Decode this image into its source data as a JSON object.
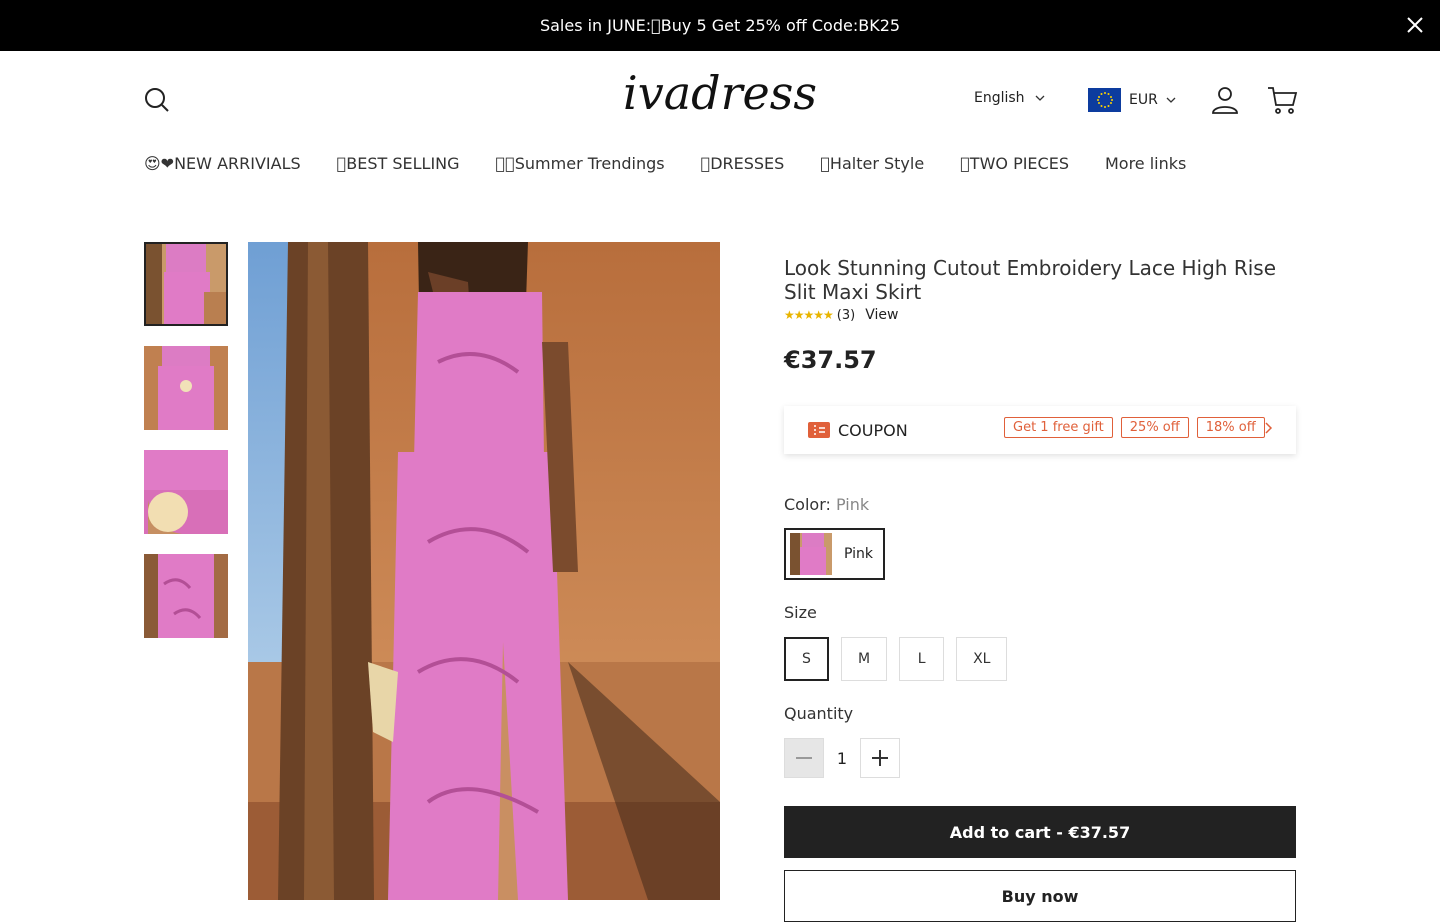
{
  "announcement": {
    "text": "Sales in JUNE:\u0000Buy 5 Get 25% off Code:BK25"
  },
  "header": {
    "logo_text": "ivadress",
    "language": "English",
    "currency": "EUR"
  },
  "nav": {
    "items": [
      "😍❤NEW ARRIVIALS",
      "\u0000BEST SELLING",
      "\u0000\u0000Summer Trendings",
      "\u0000DRESSES",
      "\u0000Halter Style",
      "\u0000TWO PIECES",
      "More links"
    ]
  },
  "product": {
    "title": "Look Stunning Cutout Embroidery Lace High Rise Slit Maxi Skirt",
    "stars": "★★★★★",
    "review_count": "(3)",
    "view_label": "View",
    "price": "€37.57",
    "coupon": {
      "label": "COUPON",
      "tags": [
        "Get 1 free gift",
        "25% off",
        "18% off"
      ]
    },
    "color_label": "Color:",
    "color_value": "Pink",
    "color_option": "Pink",
    "size_label": "Size",
    "sizes": [
      "S",
      "M",
      "L",
      "XL"
    ],
    "selected_size": "S",
    "quantity_label": "Quantity",
    "quantity": "1",
    "add_to_cart": "Add to cart - €37.57",
    "buy_now": "Buy now"
  },
  "colors": {
    "announcement_bg": "#000000",
    "primary_button": "#222222",
    "coupon_accent": "#e0603a",
    "product_pink": "#e07bc6"
  }
}
